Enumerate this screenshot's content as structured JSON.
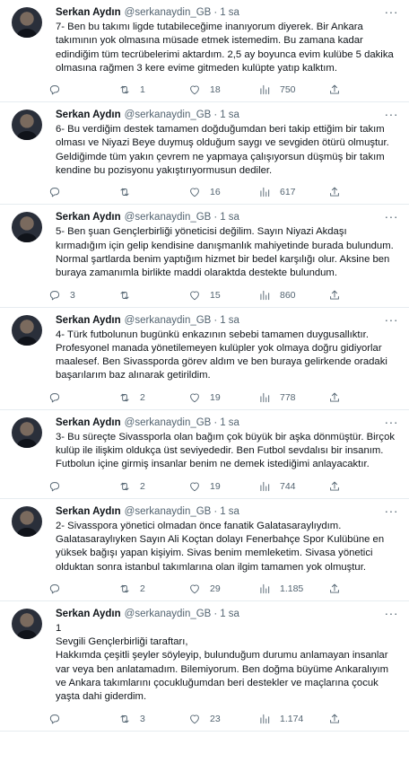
{
  "tweets": [
    {
      "author": "Serkan Aydın",
      "handle": "@serkanaydin_GB",
      "separator": "·",
      "time": "1 sa",
      "text": "7- Ben bu takımı ligde tutabileceğime inanıyorum diyerek. Bir Ankara takımının yok olmasına müsade etmek istemedim. Bu zamana kadar edindiğim tüm tecrübelerimi aktardım. 2,5 ay boyunca evim kulübe 5 dakika olmasına rağmen 3 kere evime gitmeden kulüpte yatıp kalktım.",
      "replies": "",
      "retweets": "1",
      "likes": "18",
      "views": "750"
    },
    {
      "author": "Serkan Aydın",
      "handle": "@serkanaydin_GB",
      "separator": "·",
      "time": "1 sa",
      "text": "6- Bu verdiğim destek tamamen doğduğumdan beri takip ettiğim bir takım olması ve Niyazi Beye duymuş olduğum saygı ve sevgiden ötürü olmuştur. Geldiğimde tüm yakın çevrem ne yapmaya çalışıyorsun düşmüş bir takım kendine bu pozisyonu yakıştırıyormusun dediler.",
      "replies": "",
      "retweets": "",
      "likes": "16",
      "views": "617"
    },
    {
      "author": "Serkan Aydın",
      "handle": "@serkanaydin_GB",
      "separator": "·",
      "time": "1 sa",
      "text": "5- Ben şuan Gençlerbirliği yöneticisi değilim. Sayın Niyazi Akdaşı kırmadığım için gelip kendisine danışmanlık mahiyetinde burada bulundum. Normal şartlarda benim yaptığım hizmet bir bedel karşılığı olur. Aksine ben buraya zamanımla birlikte maddi olaraktda destekte bulundum.",
      "replies": "3",
      "retweets": "",
      "likes": "15",
      "views": "860"
    },
    {
      "author": "Serkan Aydın",
      "handle": "@serkanaydin_GB",
      "separator": "·",
      "time": "1 sa",
      "text": "4- Türk futbolunun bugünkü enkazının sebebi tamamen duygusallıktır. Profesyonel manada yönetilemeyen kulüpler yok olmaya doğru gidiyorlar maalesef. Ben Sivassporda görev aldım ve ben buraya gelirkende oradaki başarılarım baz alınarak getirildim.",
      "replies": "",
      "retweets": "2",
      "likes": "19",
      "views": "778"
    },
    {
      "author": "Serkan Aydın",
      "handle": "@serkanaydin_GB",
      "separator": "·",
      "time": "1 sa",
      "text": "3- Bu süreçte Sivassporla olan bağım çok büyük bir aşka dönmüştür. Birçok kulüp ile ilişkim oldukça üst seviyededir. Ben Futbol sevdalısı bir insanım. Futbolun içine girmiş insanlar benim ne demek istediğimi anlayacaktır.",
      "replies": "",
      "retweets": "2",
      "likes": "19",
      "views": "744"
    },
    {
      "author": "Serkan Aydın",
      "handle": "@serkanaydin_GB",
      "separator": "·",
      "time": "1 sa",
      "text": "2- Sivasspora yönetici olmadan önce fanatik Galatasaraylıydım. Galatasaraylıyken Sayın Ali Koçtan dolayı Fenerbahçe Spor Kulübüne en yüksek bağışı yapan kişiyim. Sivas benim memleketim. Sivasa yönetici olduktan sonra istanbul takımlarına olan ilgim tamamen yok olmuştur.",
      "replies": "",
      "retweets": "2",
      "likes": "29",
      "views": "1.185"
    },
    {
      "author": "Serkan Aydın",
      "handle": "@serkanaydin_GB",
      "separator": "·",
      "time": "1 sa",
      "text": "1\nSevgili Gençlerbirliği taraftarı,\nHakkımda çeşitli şeyler söyleyip, bulunduğum durumu anlamayan insanlar var veya ben anlatamadım. Bilemiyorum. Ben doğma büyüme Ankaralıyım ve Ankara takımlarını çocukluğumdan beri destekler ve maçlarına çocuk yaşta dahi giderdim.",
      "replies": "",
      "retweets": "3",
      "likes": "23",
      "views": "1.174"
    }
  ],
  "icons": {
    "more": "more-horizontal-icon",
    "reply": "reply-icon",
    "retweet": "retweet-icon",
    "like": "heart-icon",
    "views": "views-chart-icon",
    "share": "share-icon"
  },
  "more_glyph": "···"
}
